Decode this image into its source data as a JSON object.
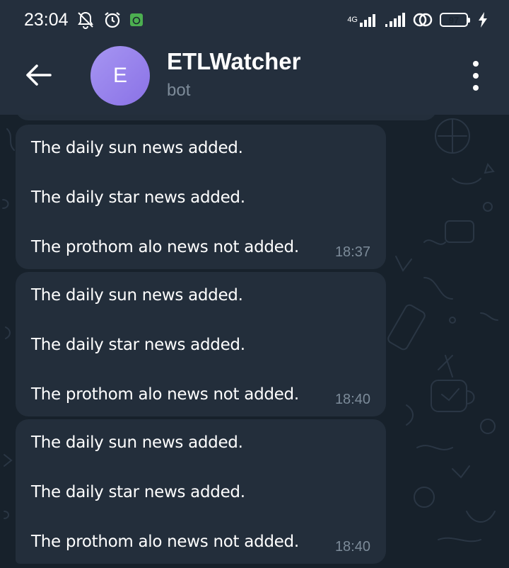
{
  "status_bar": {
    "time": "23:04",
    "network_label": "4G",
    "battery_level": "97",
    "icons": [
      "mute-icon",
      "alarm-icon",
      "app-notification-icon",
      "signal-icon",
      "signal-icon",
      "hotspot-icon",
      "battery-icon",
      "charging-icon"
    ]
  },
  "header": {
    "avatar_letter": "E",
    "title": "ETLWatcher",
    "subtitle": "bot",
    "icons": [
      "back-arrow-icon",
      "more-vertical-icon"
    ]
  },
  "messages": [
    {
      "lines": [
        "The daily sun news added.",
        "The daily star news added.",
        "The prothom alo news not added."
      ],
      "time": "18:37"
    },
    {
      "lines": [
        "The daily sun news added.",
        "The daily star news added.",
        "The prothom alo news not added."
      ],
      "time": "18:40"
    },
    {
      "lines": [
        "The daily sun news added.",
        "The daily star news added.",
        "The prothom alo news not added."
      ],
      "time": "18:40"
    }
  ],
  "colors": {
    "header_bg": "#242f3d",
    "chat_bg": "#17212b",
    "bubble_bg": "#232e3b",
    "avatar": "#9a85ee",
    "subtitle": "#7d8b99",
    "battery_green": "#7bd06a"
  }
}
